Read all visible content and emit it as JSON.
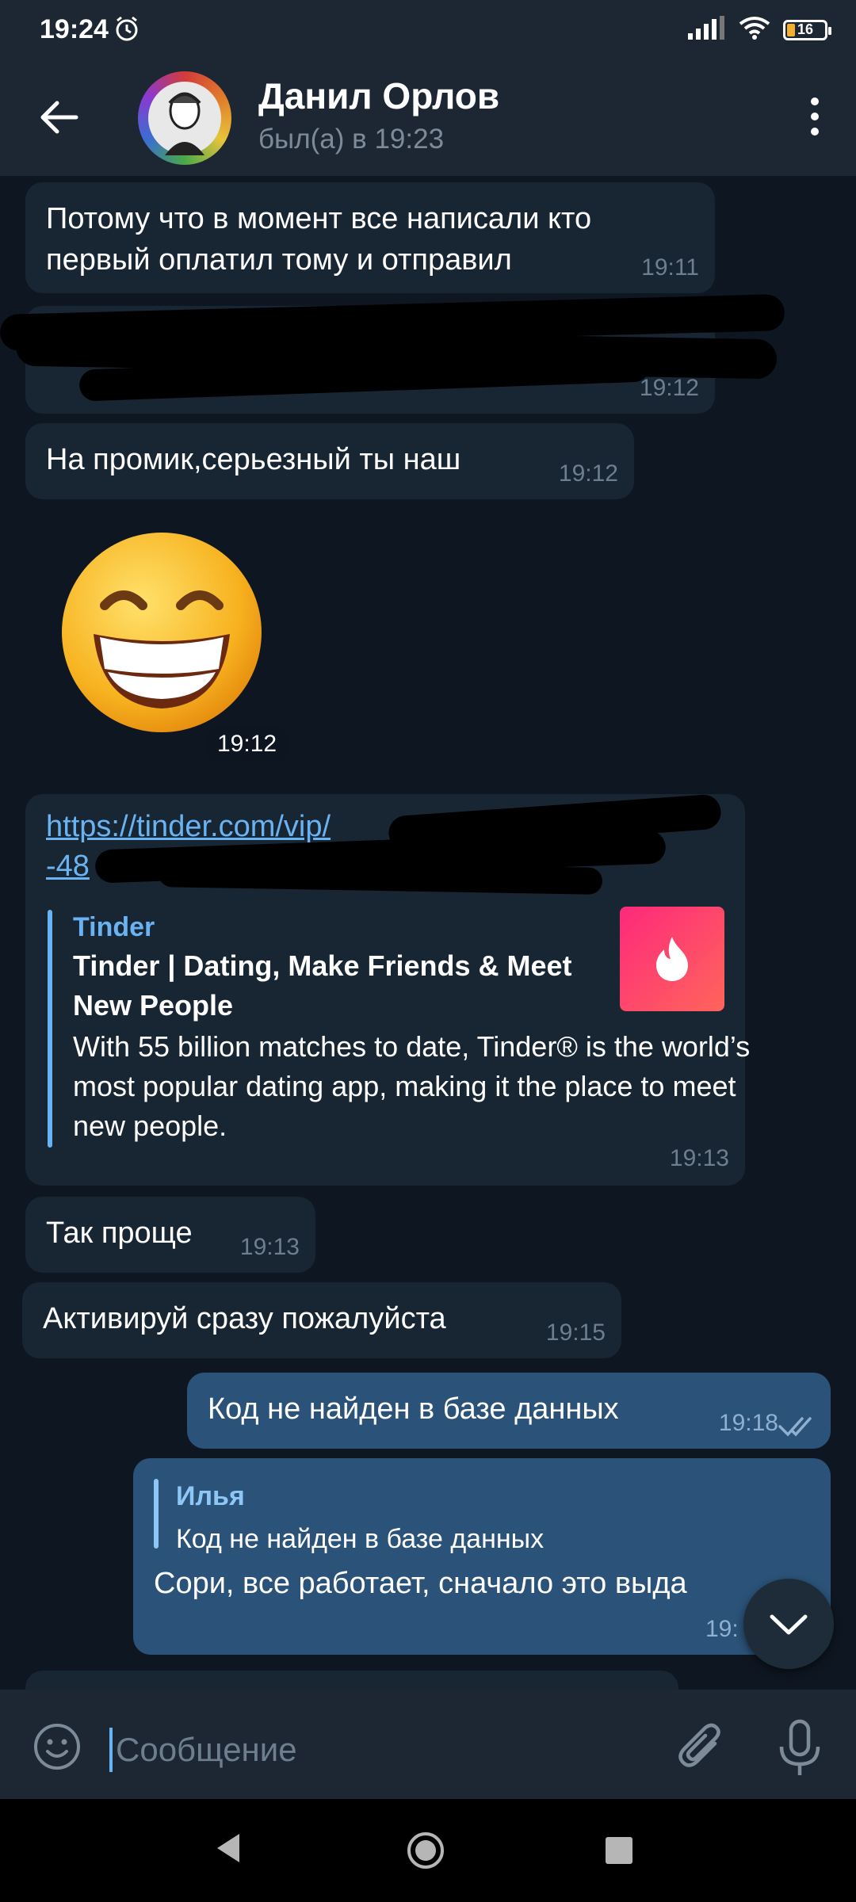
{
  "status_bar": {
    "time": "19:24",
    "battery": "16"
  },
  "header": {
    "contact_name": "Данил Орлов",
    "contact_status": "был(а) в 19:23"
  },
  "messages": [
    {
      "direction": "in",
      "text": "Потому что в момент все написали кто первый оплатил тому и отправил",
      "time": "19:11"
    },
    {
      "direction": "in",
      "text": "[redacted]",
      "time": "19:12",
      "redacted": true
    },
    {
      "direction": "in",
      "text": "На промик,серьезный ты наш",
      "time": "19:12"
    },
    {
      "direction": "in",
      "type": "sticker",
      "emoji": "😁",
      "time": "19:12"
    },
    {
      "direction": "in",
      "type": "link",
      "url_visible": "https://tinder.com/vip/",
      "url_line2": "-48",
      "preview": {
        "site": "Tinder",
        "title": "Tinder | Dating, Make Friends & Meet New People",
        "description": "With 55 billion matches to date, Tinder® is the world’s most popular dating app, making it the place to meet new people."
      },
      "time": "19:13"
    },
    {
      "direction": "in",
      "text": "Так проще",
      "time": "19:13"
    },
    {
      "direction": "in",
      "text": "Активируй сразу пожалуйста",
      "time": "19:15"
    },
    {
      "direction": "out",
      "text": "Код не найден в базе данных",
      "time": "19:18",
      "read": true
    },
    {
      "direction": "out",
      "type": "reply",
      "reply_to": {
        "name": "Илья",
        "text": "Код не найден в базе данных"
      },
      "text": "Сори, все работает, сначало это выда",
      "time": "19:"
    }
  ],
  "input": {
    "placeholder": "Сообщение"
  },
  "colors": {
    "background": "#0e1621",
    "bubble_in": "#182533",
    "bubble_out": "#2b5278",
    "header": "#1d2733",
    "accent": "#6ab3f3"
  }
}
